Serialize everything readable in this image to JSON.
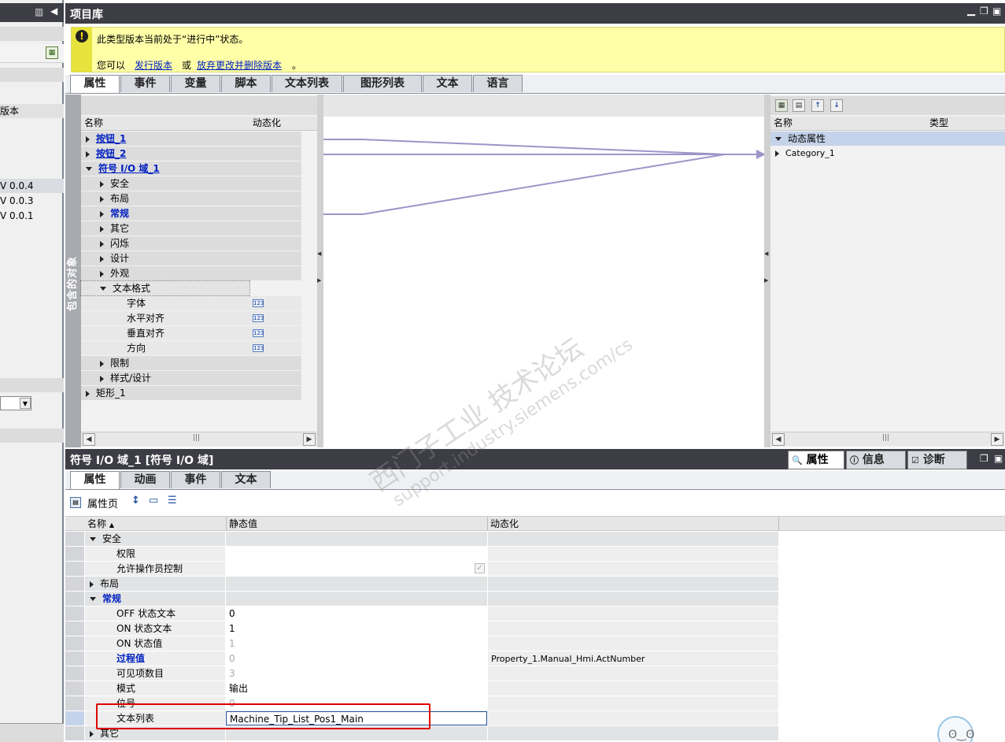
{
  "left_panel": {
    "items": [
      "版本",
      "V 0.0.4",
      "V 0.0.3",
      "V 0.0.1"
    ]
  },
  "library": {
    "title": "项目库",
    "warning_line1": "此类型版本当前处于“进行中”状态。",
    "warning_prefix": "您可以",
    "warning_link1": "发行版本",
    "warning_or": "或",
    "warning_link2": "放弃更改并删除版本",
    "warning_end": "。",
    "tabs": [
      "属性",
      "事件",
      "变量",
      "脚本",
      "文本列表",
      "图形列表",
      "文本",
      "语言"
    ],
    "vertical_label": "包含的对象",
    "tree_header": {
      "name": "名称",
      "dynamic": "动态化"
    },
    "tree": [
      {
        "label": "按钮_1",
        "level": 0,
        "expand": "r",
        "style": "link"
      },
      {
        "label": "按钮_2",
        "level": 0,
        "expand": "r",
        "style": "link"
      },
      {
        "label": "符号 I/O 域_1",
        "level": 0,
        "expand": "d",
        "style": "link"
      },
      {
        "label": "安全",
        "level": 1,
        "expand": "r",
        "style": ""
      },
      {
        "label": "布局",
        "level": 1,
        "expand": "r",
        "style": ""
      },
      {
        "label": "常规",
        "level": 1,
        "expand": "r",
        "style": "blue"
      },
      {
        "label": "其它",
        "level": 1,
        "expand": "r",
        "style": ""
      },
      {
        "label": "闪烁",
        "level": 1,
        "expand": "r",
        "style": ""
      },
      {
        "label": "设计",
        "level": 1,
        "expand": "r",
        "style": ""
      },
      {
        "label": "外观",
        "level": 1,
        "expand": "r",
        "style": ""
      },
      {
        "label": "文本格式",
        "level": 1,
        "expand": "d",
        "style": ""
      },
      {
        "label": "字体",
        "level": 2,
        "expand": "",
        "style": "",
        "icon": "123"
      },
      {
        "label": "水平对齐",
        "level": 2,
        "expand": "",
        "style": "",
        "icon": "123"
      },
      {
        "label": "垂直对齐",
        "level": 2,
        "expand": "",
        "style": "",
        "icon": "123"
      },
      {
        "label": "方向",
        "level": 2,
        "expand": "",
        "style": "",
        "icon": "123"
      },
      {
        "label": "限制",
        "level": 1,
        "expand": "r",
        "style": ""
      },
      {
        "label": "样式/设计",
        "level": 1,
        "expand": "r",
        "style": ""
      },
      {
        "label": "矩形_1",
        "level": 0,
        "expand": "r",
        "style": ""
      }
    ],
    "right_header": {
      "name": "名称",
      "type": "类型"
    },
    "right_items": [
      {
        "label": "动态属性",
        "expand": "d",
        "selected": true
      },
      {
        "label": "Category_1",
        "expand": "r",
        "selected": false
      }
    ],
    "scroll_mark": "|||"
  },
  "inspector": {
    "title": "符号 I/O 域_1 [符号 I/O 域]",
    "right_tabs": [
      "属性",
      "信息",
      "诊断"
    ],
    "tabs": [
      "属性",
      "动画",
      "事件",
      "文本"
    ],
    "toolbar_label": "属性页",
    "header": {
      "name": "名称",
      "static": "静态值",
      "dynamic": "动态化"
    },
    "rows": [
      {
        "name": "安全",
        "level": 0,
        "expand": "d",
        "static": "",
        "dynamic": "",
        "group": true
      },
      {
        "name": "权限",
        "level": 1,
        "expand": "",
        "static": "",
        "dynamic": "",
        "group": false
      },
      {
        "name": "允许操作员控制",
        "level": 1,
        "expand": "",
        "static": "",
        "dynamic": "",
        "group": false,
        "checkbox": true
      },
      {
        "name": "布局",
        "level": 0,
        "expand": "r",
        "static": "",
        "dynamic": "",
        "group": true
      },
      {
        "name": "常规",
        "level": 0,
        "expand": "d",
        "static": "",
        "dynamic": "",
        "group": true,
        "blue": true
      },
      {
        "name": "OFF 状态文本",
        "level": 1,
        "expand": "",
        "static": "0",
        "dynamic": "",
        "group": false
      },
      {
        "name": "ON 状态文本",
        "level": 1,
        "expand": "",
        "static": "1",
        "dynamic": "",
        "group": false
      },
      {
        "name": "ON 状态值",
        "level": 1,
        "expand": "",
        "static": "1",
        "dynamic": "",
        "group": false,
        "greyval": true
      },
      {
        "name": "过程值",
        "level": 1,
        "expand": "",
        "static": "0",
        "dynamic": "Property_1.Manual_Hmi.ActNumber",
        "group": false,
        "blue": true,
        "greyval": true
      },
      {
        "name": "可见项数目",
        "level": 1,
        "expand": "",
        "static": "3",
        "dynamic": "",
        "group": false,
        "greyval": true
      },
      {
        "name": "模式",
        "level": 1,
        "expand": "",
        "static": "输出",
        "dynamic": "",
        "group": false
      },
      {
        "name": "位号",
        "level": 1,
        "expand": "",
        "static": "0",
        "dynamic": "",
        "group": false,
        "greyval": true
      },
      {
        "name": "文本列表",
        "level": 1,
        "expand": "",
        "static": "Machine_Tip_List_Pos1_Main",
        "dynamic": "",
        "group": false,
        "selected": true
      },
      {
        "name": "其它",
        "level": 0,
        "expand": "r",
        "static": "",
        "dynamic": "",
        "group": true
      }
    ]
  },
  "watermark": {
    "line1": "西门子工业 技术论坛",
    "line2": "support.industry.siemens.com/cs"
  },
  "colors": {
    "title_bar": "#3c3d45",
    "warning_bg": "#ffffa8",
    "link_blue": "#0020c0",
    "highlight_red": "#e00000",
    "selected_row": "#c5d3ea"
  }
}
